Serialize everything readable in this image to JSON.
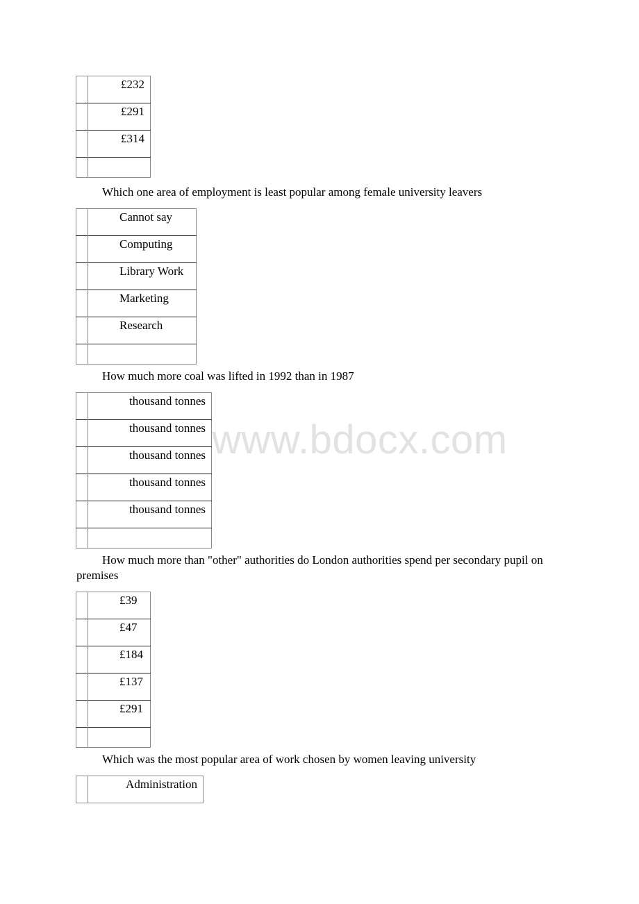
{
  "watermark": "www.bdocx.com",
  "questions": [
    {
      "prompt": "",
      "options": [
        "£232",
        "£291",
        "£314",
        ""
      ]
    },
    {
      "prompt": "Which one area of employment is least popular among female university leavers",
      "options": [
        "Cannot say",
        "Computing",
        "Library Work",
        "Marketing",
        "Research",
        ""
      ]
    },
    {
      "prompt": "How much more coal was lifted in 1992 than in 1987",
      "options": [
        "thousand tonnes",
        "thousand tonnes",
        "thousand tonnes",
        "thousand tonnes",
        "thousand tonnes",
        ""
      ]
    },
    {
      "prompt": "How much more than \"other\" authorities do London authorities spend per secondary pupil on premises",
      "options": [
        "£39",
        "£47",
        "£184",
        "£137",
        "£291",
        ""
      ]
    },
    {
      "prompt": "Which was the most popular area of work chosen by women leaving university",
      "options": [
        "Administration"
      ]
    }
  ]
}
